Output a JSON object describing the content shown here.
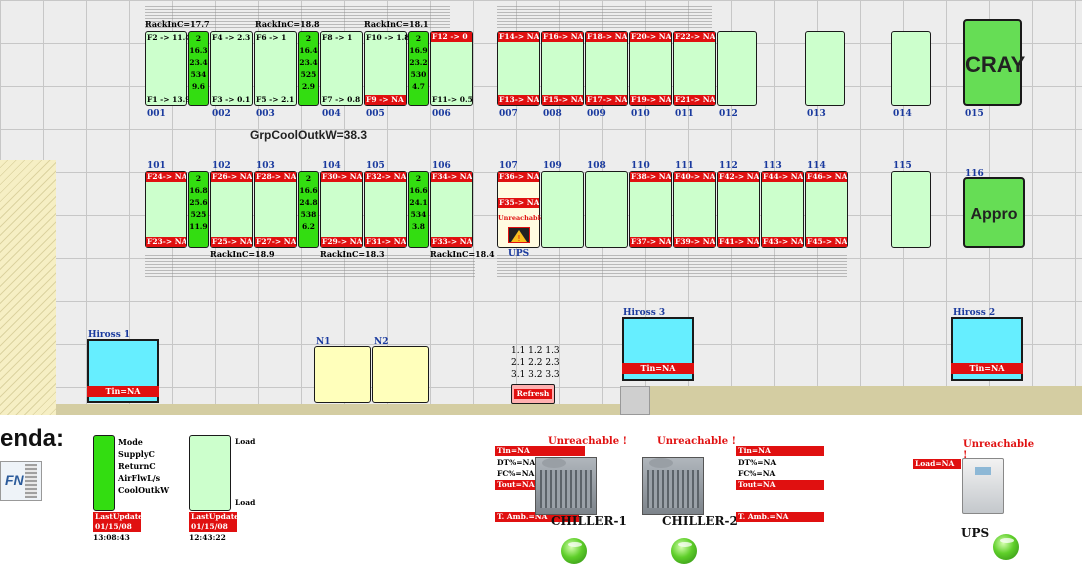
{
  "colors": {
    "rack_fill": "#ccffcc",
    "cool_unit": "#33dd11",
    "alarm_red": "#e01010",
    "hiross_fill": "#66eeff",
    "n_fill": "#ffffbb",
    "label_blue": "#1a3a9e"
  },
  "top_rackInC": [
    "RackInC=17.7",
    "RackInC=18.8",
    "RackInC=18.1"
  ],
  "row1_top_bars": {
    "pdu_f2": "F2 -> 11.4",
    "pdu_f4": "F4 -> 2.3",
    "pdu_f6": "F6 -> 1",
    "pdu_f8": "F8 -> 1",
    "pdu_f10": "F10 -> 1.8",
    "pdu_f12": "F12 -> 0",
    "f14": "F14-> NA",
    "f16": "F16-> NA",
    "f18": "F18-> NA",
    "f20": "F20-> NA",
    "f22": "F22-> NA"
  },
  "row1_bot_bars": {
    "pdu_f1": "F1 -> 13.9",
    "pdu_f3": "F3 -> 0.1",
    "pdu_f5": "F5 -> 2.1",
    "pdu_f7": "F7 -> 0.8",
    "pdu_f9": "F9 -> NA",
    "pdu_f11": "F11-> 0.5",
    "f13": "F13-> NA",
    "f15": "F15-> NA",
    "f17": "F17-> NA",
    "f19": "F19-> NA",
    "f21": "F21-> NA"
  },
  "cool1": {
    "mode": "2",
    "supply": "16.3",
    "ret": "23.4",
    "air": "534",
    "kw": "9.6"
  },
  "cool2": {
    "mode": "2",
    "supply": "16.4",
    "ret": "23.4",
    "air": "525",
    "kw": "2.9"
  },
  "cool3": {
    "mode": "2",
    "supply": "16.9",
    "ret": "23.2",
    "air": "530",
    "kw": "4.7"
  },
  "row1_numbers": [
    "001",
    "002",
    "003",
    "004",
    "005",
    "006",
    "007",
    "008",
    "009",
    "010",
    "011",
    "012",
    "013",
    "014",
    "015"
  ],
  "grp_cool": "GrpCoolOutkW=38.3",
  "row2_numbers": [
    "101",
    "102",
    "103",
    "104",
    "105",
    "106",
    "107",
    "109",
    "108",
    "110",
    "111",
    "112",
    "113",
    "114",
    "115",
    "116"
  ],
  "row2_top_bars": {
    "f24": "F24-> NA",
    "f26": "F26-> NA",
    "f28": "F28-> NA",
    "f30": "F30-> NA",
    "f32": "F32-> NA",
    "f34": "F34-> NA",
    "f36": "F36-> NA",
    "f38": "F38-> NA",
    "f40": "F40-> NA",
    "f42": "F42-> NA",
    "f44": "F44-> NA",
    "f46": "F46-> NA"
  },
  "row2_bot_bars": {
    "f23": "F23-> NA",
    "f25": "F25-> NA",
    "f27": "F27-> NA",
    "f29": "F29-> NA",
    "f31": "F31-> NA",
    "f33": "F33-> NA",
    "f35": "F35-> NA",
    "f37": "F37-> NA",
    "f39": "F39-> NA",
    "f41": "F41-> NA",
    "f43": "F43-> NA",
    "f45": "F45-> NA"
  },
  "cool4": {
    "mode": "2",
    "supply": "16.8",
    "ret": "25.6",
    "air": "525",
    "kw": "11.9"
  },
  "cool5": {
    "mode": "2",
    "supply": "16.6",
    "ret": "24.8",
    "air": "538",
    "kw": "6.2"
  },
  "cool6": {
    "mode": "2",
    "supply": "16.6",
    "ret": "24.1",
    "air": "534",
    "kw": "3.8"
  },
  "bot_rackInC": [
    "RackInC=18.9",
    "RackInC=18.3",
    "RackInC=18.4"
  ],
  "ups_small": {
    "unreach": "Unreachable",
    "label": "UPS"
  },
  "big_boxes": {
    "cray": "CRAY",
    "appro": "Appro"
  },
  "hiross": [
    {
      "name": "Hiross 1",
      "bar": "Tin=NA"
    },
    {
      "name": "Hiross 3",
      "bar": "Tin=NA"
    },
    {
      "name": "Hiross 2",
      "bar": "Tin=NA"
    }
  ],
  "n_labels": [
    "N1",
    "N2"
  ],
  "grid33": [
    "1.1  1.2  1.3",
    "2.1  2.2  2.3",
    "3.1  3.2  3.3"
  ],
  "refresh": "Refresh",
  "legend": {
    "title": "enda:",
    "logo": "FN",
    "mode_lines": [
      "Mode",
      "SupplyC",
      "ReturnC",
      "AirFlwL/s",
      "CoolOutkW"
    ],
    "load_top": "Load",
    "load_bot": "Load",
    "last1": "LastUpdate",
    "date1": "01/15/08",
    "time1": "13:08:43",
    "last2": "LastUpdate",
    "date2": "01/15/08",
    "time2": "12:43:22"
  },
  "chillers": {
    "left_unreach": "Unreachable !",
    "left_rows": [
      "Tin=NA",
      "DT%=NA",
      "FC%=NA",
      "Tout=NA"
    ],
    "left_amb": "T. Amb.=NA",
    "chiller1": "CHILLER-1",
    "mid_unreach": "Unreachable !",
    "right_rows": [
      "Tin=NA",
      "DT%=NA",
      "FC%=NA",
      "Tout=NA"
    ],
    "right_amb": "T. Amb.=NA",
    "chiller2": "CHILLER-2"
  },
  "ups_big": {
    "unreach": "Unreachable !",
    "load": "Load=NA",
    "label": "UPS"
  }
}
